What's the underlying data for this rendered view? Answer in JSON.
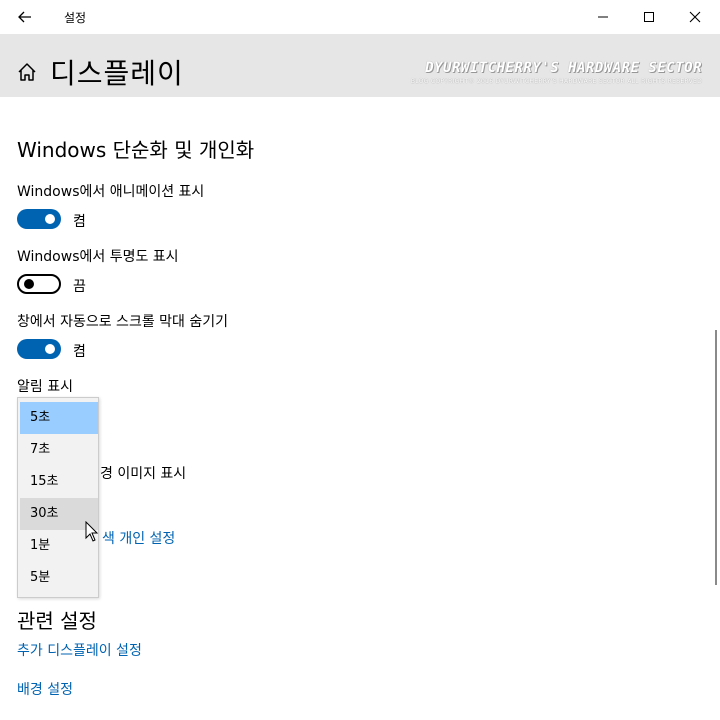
{
  "window": {
    "title": "설정",
    "back_icon": "back-arrow-icon",
    "minimize_icon": "minimize-icon",
    "maximize_icon": "maximize-icon",
    "close_icon": "close-icon"
  },
  "header": {
    "home_icon": "home-icon",
    "page_title": "디스플레이",
    "watermark": "DYURWITCHERRY'S HARDWARE SECTOR",
    "watermark_sub": "BLOG COPYRIGHT© 2016 DYURWITCHERRY'S HARDWARE SECTOR ALL RIGHTS RESERVED"
  },
  "section": {
    "title": "Windows 단순화 및 개인화",
    "settings": [
      {
        "label": "Windows에서 애니메이션 표시",
        "state": "켬",
        "on": true
      },
      {
        "label": "Windows에서 투명도 표시",
        "state": "끔",
        "on": false
      },
      {
        "label": "창에서 자동으로 스크롤 막대 숨기기",
        "state": "켬",
        "on": true
      }
    ],
    "notification_label": "알림 표시",
    "background_label_partial": "경 이미지 표시",
    "color_link_partial": "색 개인 설정"
  },
  "dropdown": {
    "options": [
      "5초",
      "7초",
      "15초",
      "30초",
      "1분",
      "5분"
    ],
    "selected": "5초",
    "hovered": "30초"
  },
  "related": {
    "title": "관련 설정",
    "links": [
      "추가 디스플레이 설정",
      "배경 설정"
    ]
  },
  "colors": {
    "accent": "#0063b1",
    "header_bg": "#e6e6e6",
    "selected_bg": "#99ccff",
    "hover_bg": "#dadada"
  }
}
